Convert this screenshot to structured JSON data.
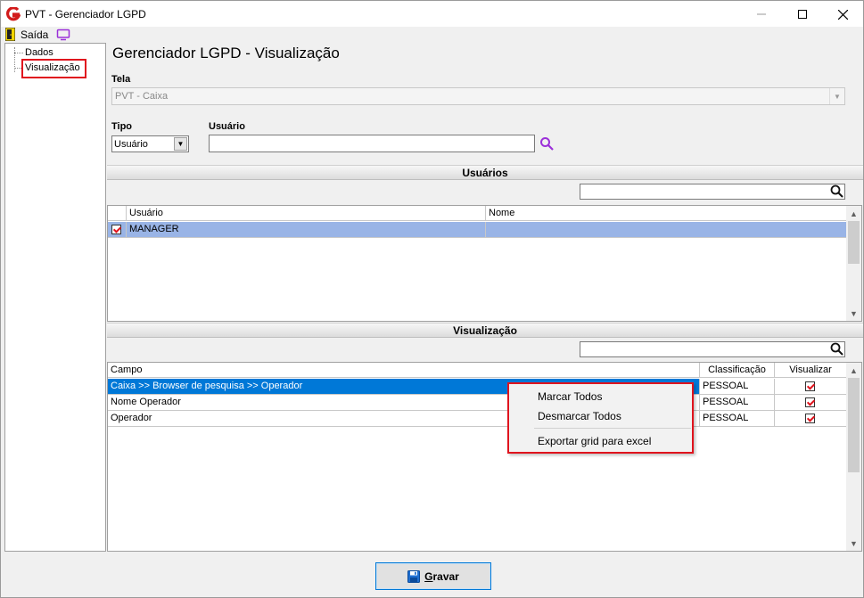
{
  "window": {
    "title": "PVT - Gerenciador LGPD",
    "minimize_icon": "minimize-icon",
    "maximize_icon": "maximize-icon",
    "close_icon": "close-icon"
  },
  "menu": {
    "exit_label": "Saída"
  },
  "tree": {
    "items": [
      {
        "label": "Dados"
      },
      {
        "label": "Visualização"
      }
    ]
  },
  "page": {
    "title": "Gerenciador LGPD - Visualização"
  },
  "form": {
    "tela_label": "Tela",
    "tela_value": "PVT - Caixa",
    "tipo_label": "Tipo",
    "tipo_value": "Usuário",
    "usuario_label": "Usuário",
    "usuario_value": ""
  },
  "users_section": {
    "title": "Usuários",
    "search_value": "",
    "columns": [
      "Usuário",
      "Nome"
    ],
    "rows": [
      {
        "checked": true,
        "usuario": "MANAGER",
        "nome": ""
      }
    ]
  },
  "view_section": {
    "title": "Visualização",
    "search_value": "",
    "columns": [
      "Campo",
      "Classificação",
      "Visualizar"
    ],
    "rows": [
      {
        "campo": "Caixa >> Browser de pesquisa >> Operador",
        "classificacao": "PESSOAL",
        "visualizar": true
      },
      {
        "campo": "Nome Operador",
        "classificacao": "PESSOAL",
        "visualizar": true
      },
      {
        "campo": "Operador",
        "classificacao": "PESSOAL",
        "visualizar": true
      }
    ]
  },
  "context_menu": {
    "items": [
      "Marcar Todos",
      "Desmarcar Todos",
      "Exportar grid para excel"
    ]
  },
  "footer": {
    "save_prefix": "G",
    "save_rest": "ravar"
  },
  "colors": {
    "highlight_red": "#e0141e",
    "selection_blue": "#0078d7",
    "user_row_blue": "#99b4e6",
    "search_icon_purple": "#9b30d9"
  }
}
